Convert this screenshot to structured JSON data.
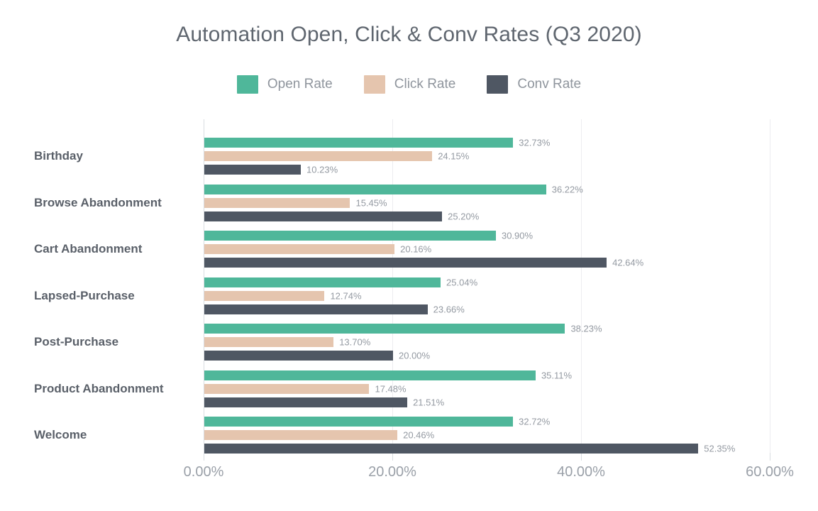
{
  "chart_data": {
    "type": "bar",
    "orientation": "horizontal",
    "title": "Automation Open, Click & Conv Rates (Q3 2020)",
    "xlabel": "",
    "ylabel": "",
    "xlim": [
      0,
      60
    ],
    "grid": true,
    "legend_position": "top-center",
    "xtick_labels": [
      "0.00%",
      "20.00%",
      "40.00%",
      "60.00%"
    ],
    "xticks": [
      0,
      20,
      40,
      60
    ],
    "categories": [
      "Birthday",
      "Browse Abandonment",
      "Cart Abandonment",
      "Lapsed-Purchase",
      "Post-Purchase",
      "Product Abandonment",
      "Welcome"
    ],
    "series": [
      {
        "name": "Open Rate",
        "color": "#4FB79A",
        "values": [
          32.73,
          36.22,
          30.9,
          25.04,
          38.23,
          35.11,
          32.72
        ],
        "labels": [
          "32.73%",
          "36.22%",
          "30.90%",
          "25.04%",
          "38.23%",
          "35.11%",
          "32.72%"
        ]
      },
      {
        "name": "Click Rate",
        "color": "#E5C5AE",
        "values": [
          24.15,
          15.45,
          20.16,
          12.74,
          13.7,
          17.48,
          20.46
        ],
        "labels": [
          "24.15%",
          "15.45%",
          "20.16%",
          "12.74%",
          "13.70%",
          "17.48%",
          "20.46%"
        ]
      },
      {
        "name": "Conv Rate",
        "color": "#4F5763",
        "values": [
          10.23,
          25.2,
          42.64,
          23.66,
          20.0,
          21.51,
          52.35
        ],
        "labels": [
          "10.23%",
          "25.20%",
          "42.64%",
          "23.66%",
          "20.00%",
          "21.51%",
          "52.35%"
        ]
      }
    ]
  },
  "legend": {
    "items": [
      {
        "label": "Open Rate",
        "color": "#4FB79A"
      },
      {
        "label": "Click Rate",
        "color": "#E5C5AE"
      },
      {
        "label": "Conv Rate",
        "color": "#4F5763"
      }
    ]
  },
  "colors": {
    "open_rate": "#4FB79A",
    "click_rate": "#E5C5AE",
    "conv_rate": "#4F5763",
    "title_text": "#5f666f",
    "category_text": "#5a6069",
    "value_text": "#949aa2",
    "axis_text": "#9aa0a8",
    "gridline": "#ededf0",
    "background": "#ffffff"
  }
}
